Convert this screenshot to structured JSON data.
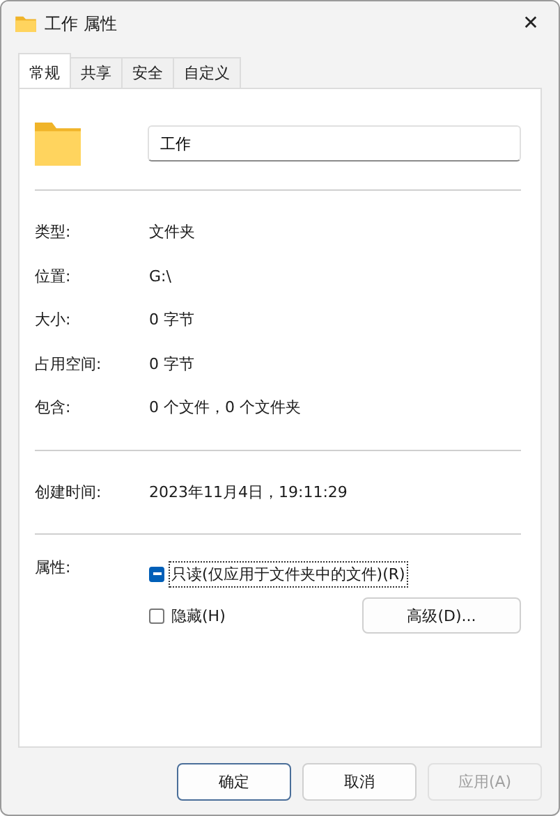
{
  "window": {
    "title": "工作 属性",
    "close": "✕"
  },
  "tabs": [
    {
      "label": "常规",
      "selected": true
    },
    {
      "label": "共享",
      "selected": false
    },
    {
      "label": "安全",
      "selected": false
    },
    {
      "label": "自定义",
      "selected": false
    }
  ],
  "name_field": {
    "value": "工作"
  },
  "info_groups": [
    [
      {
        "label": "类型:",
        "value": "文件夹"
      },
      {
        "label": "位置:",
        "value": "G:\\"
      },
      {
        "label": "大小:",
        "value": "0 字节"
      },
      {
        "label": "占用空间:",
        "value": "0 字节"
      },
      {
        "label": "包含:",
        "value": "0 个文件，0 个文件夹"
      }
    ],
    [
      {
        "label": "创建时间:",
        "value": "2023年11月4日，19:11:29"
      }
    ]
  ],
  "attributes": {
    "label": "属性:",
    "options": [
      {
        "label": "只读(仅应用于文件夹中的文件)(R)",
        "checked": true,
        "indeterminate": true,
        "focused": true
      },
      {
        "label": "隐藏(H)",
        "checked": false,
        "focused": false
      }
    ],
    "advanced_button": "高级(D)..."
  },
  "buttons": [
    {
      "label": "确定",
      "kind": "default",
      "disabled": false
    },
    {
      "label": "取消",
      "kind": "normal",
      "disabled": false
    },
    {
      "label": "应用(A)",
      "kind": "normal",
      "disabled": true
    }
  ]
}
